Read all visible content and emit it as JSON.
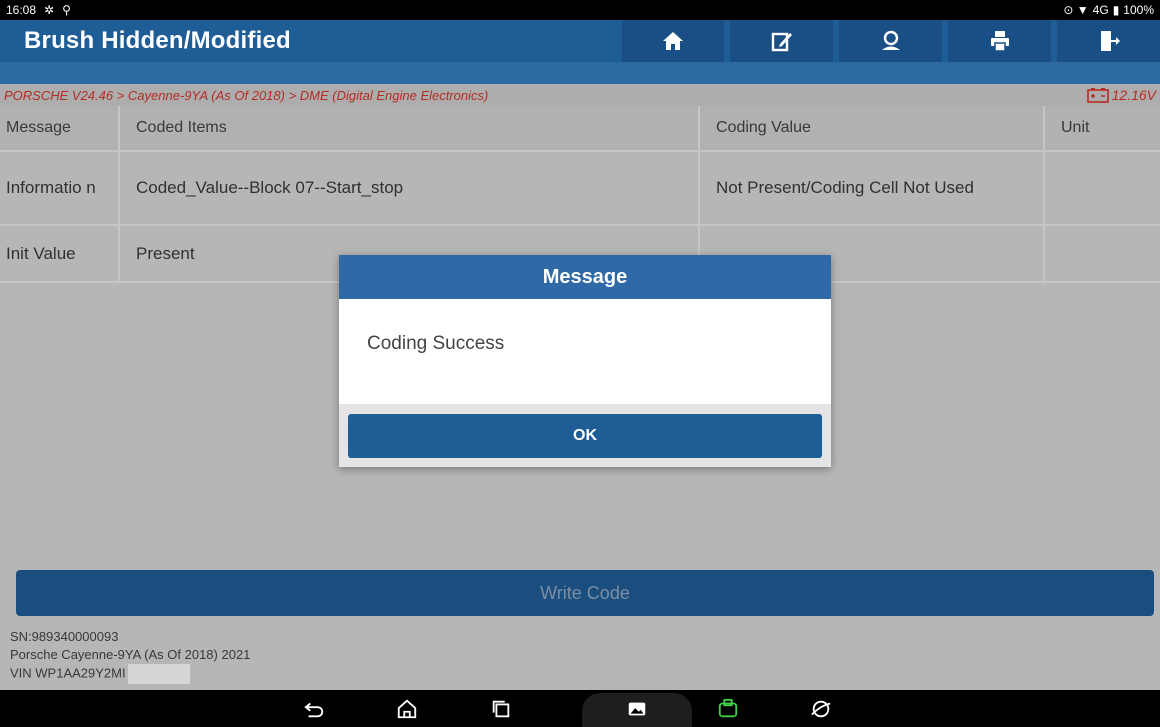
{
  "status_bar": {
    "time": "16:08",
    "network": "4G",
    "battery": "100%"
  },
  "titlebar": {
    "title": "Brush Hidden/Modified",
    "buttons": [
      "home-icon",
      "edit-icon",
      "user-icon",
      "print-icon",
      "exit-icon"
    ]
  },
  "breadcrumb": {
    "path": "PORSCHE V24.46 > Cayenne-9YA (As Of 2018) > DME (Digital Engine Electronics)",
    "voltage": "12.16V"
  },
  "table": {
    "headers": [
      "Message",
      "Coded Items",
      "Coding Value",
      "Unit"
    ],
    "rows": [
      [
        "Informatio n",
        "Coded_Value--Block 07--Start_stop",
        "Not Present/Coding Cell Not Used",
        ""
      ],
      [
        "Init Value",
        "Present",
        "",
        ""
      ]
    ]
  },
  "write_button": "Write Code",
  "footer": {
    "sn": "SN:989340000093",
    "vehicle": "Porsche Cayenne-9YA (As Of 2018) 2021",
    "vin": "VIN WP1AA29Y2MI"
  },
  "dialog": {
    "title": "Message",
    "body": "Coding Success",
    "ok_label": "OK"
  },
  "colors": {
    "brand": "#1f5d97",
    "breadcrumb_text": "#d8352b"
  }
}
